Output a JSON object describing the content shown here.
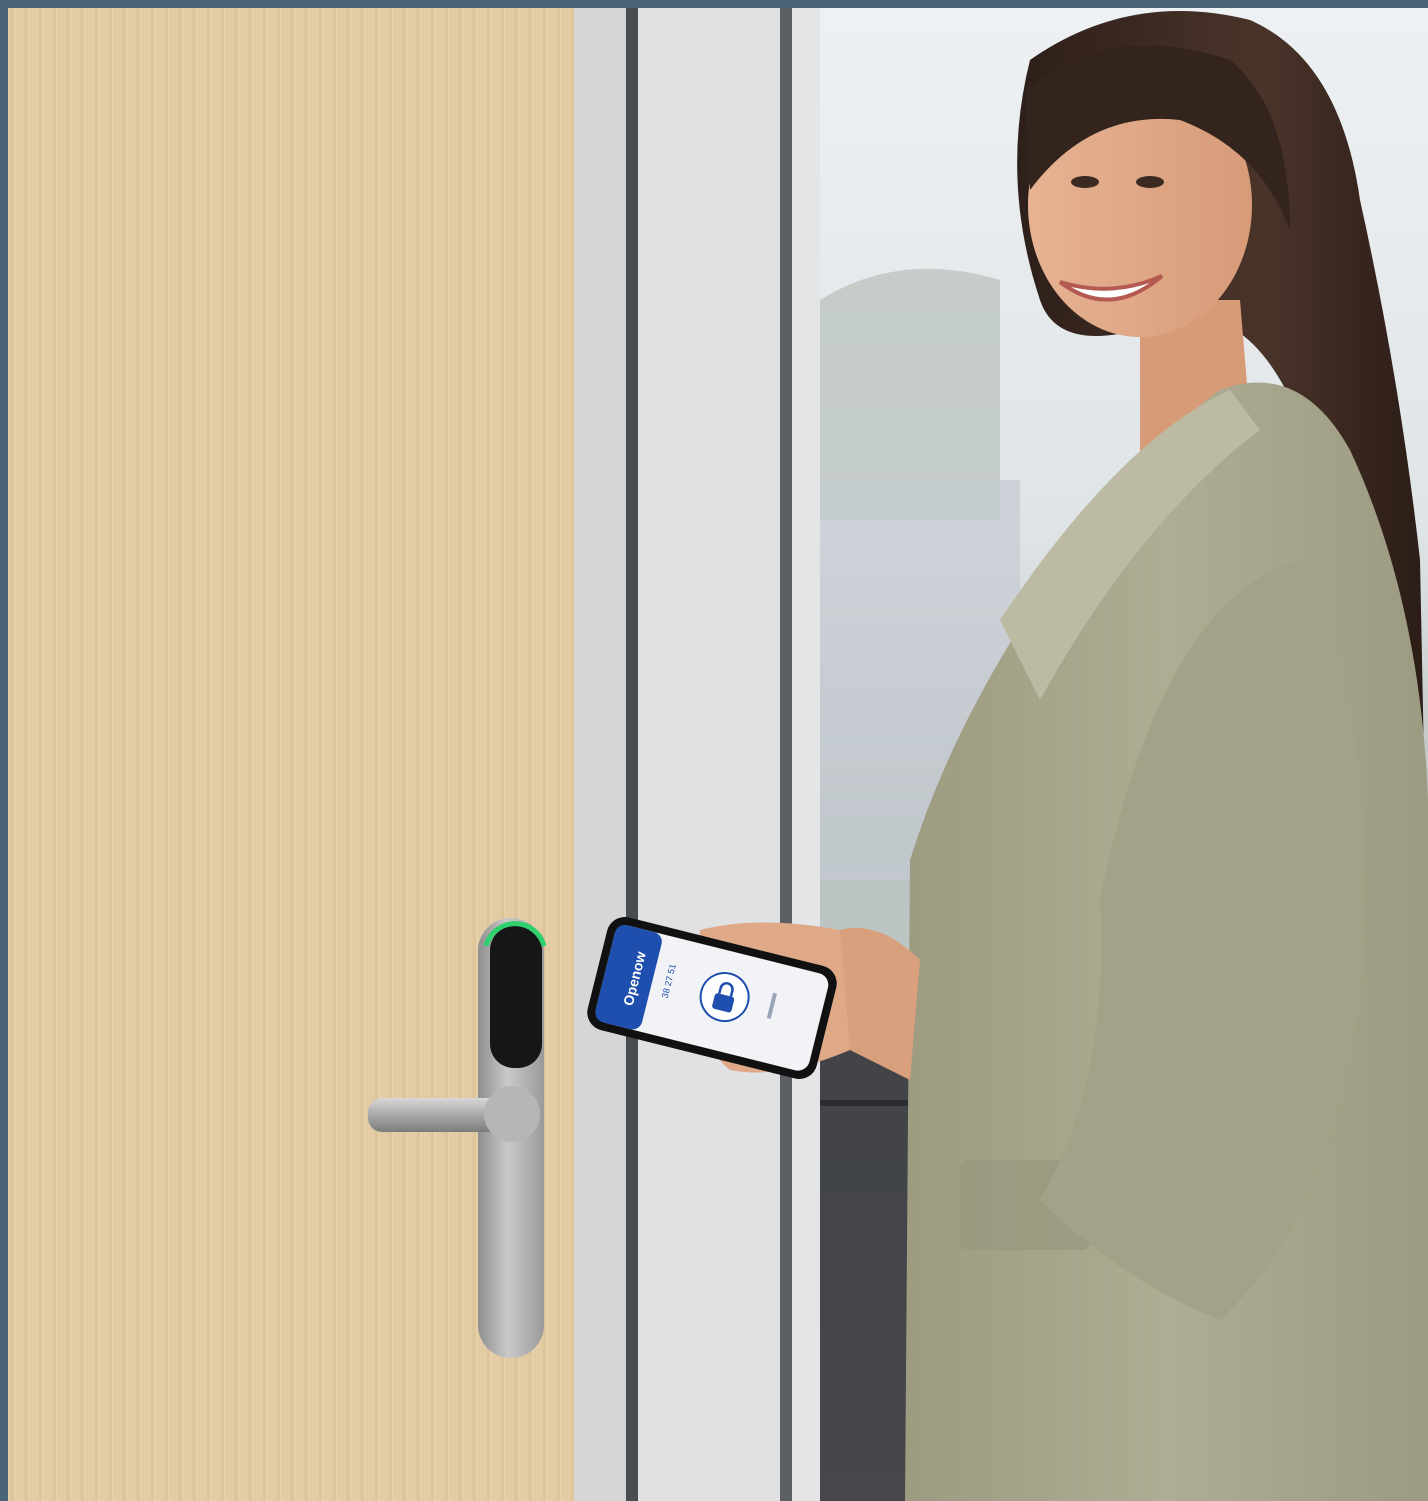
{
  "frame": {
    "border_color": "#4a6378"
  },
  "door": {
    "color": "#e2cca6"
  },
  "wall": {
    "color": "#dddfe0"
  },
  "window": {
    "sky_color": "#e9edf0"
  },
  "person": {
    "blazer_color": "#aaa88d",
    "hair_color": "#3b2a22"
  },
  "lock": {
    "status_led_color": "#2fd16e",
    "reader_color": "#161616",
    "finish": "brushed-steel"
  },
  "phone": {
    "app_name": "Openow",
    "app_header_color": "#1e4fae",
    "code": "38 27 51",
    "lock_icon": "padlock-icon"
  }
}
